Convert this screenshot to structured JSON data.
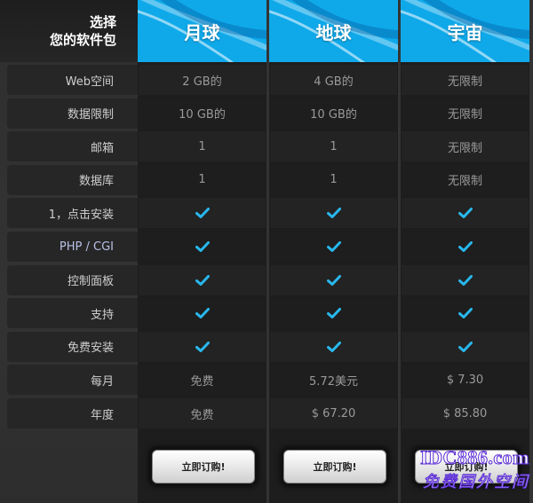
{
  "header": {
    "title_line1": "选择",
    "title_line2": "您的软件包"
  },
  "plans": [
    {
      "name": "月球"
    },
    {
      "name": "地球"
    },
    {
      "name": "宇宙"
    }
  ],
  "rows": [
    {
      "label": "Web空间",
      "values": [
        "2 GB的",
        "4 GB的",
        "无限制"
      ]
    },
    {
      "label": "数据限制",
      "values": [
        "10 GB的",
        "10 GB的",
        "无限制"
      ]
    },
    {
      "label": "邮箱",
      "values": [
        "1",
        "1",
        "无限制"
      ]
    },
    {
      "label": "数据库",
      "values": [
        "1",
        "1",
        "无限制"
      ]
    },
    {
      "label": "1，点击安装",
      "check": true
    },
    {
      "label": "PHP / CGI",
      "check": true
    },
    {
      "label": "控制面板",
      "check": true
    },
    {
      "label": "支持",
      "check": true
    },
    {
      "label": "免费安装",
      "check": true
    },
    {
      "label": "每月",
      "values": [
        "免费",
        "5.72美元",
        "$ 7.30"
      ]
    },
    {
      "label": "年度",
      "values": [
        "免费",
        "$ 67.20",
        "$ 85.80"
      ]
    }
  ],
  "buttons": {
    "order_label": "立即订购!"
  },
  "watermark": {
    "line1": "IDC886.com",
    "line2": "免费国外空间"
  },
  "colors": {
    "header_blue": "#0fa9ea",
    "check_blue": "#28b8ee"
  }
}
